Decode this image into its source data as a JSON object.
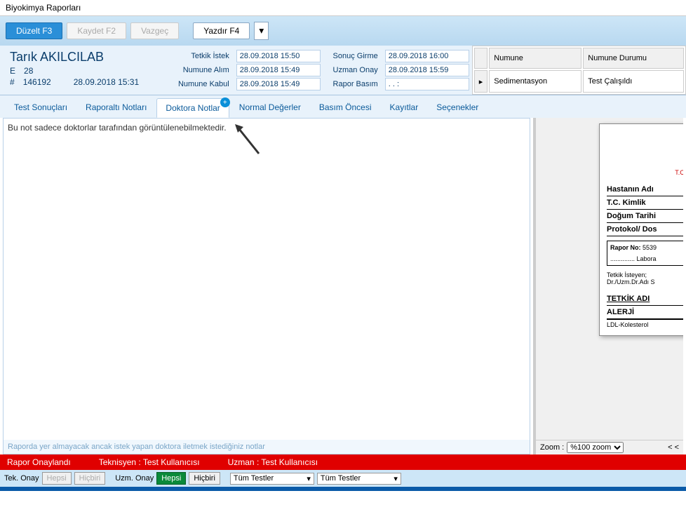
{
  "window": {
    "title": "Biyokimya Raporları"
  },
  "toolbar": {
    "edit": "Düzelt F3",
    "save": "Kaydet F2",
    "cancel": "Vazgeç",
    "print": "Yazdır F4"
  },
  "patient": {
    "name": "Tarık AKILCILAB",
    "gender": "E",
    "age": "28",
    "file_no_prefix": "#",
    "file_no": "146192",
    "file_date": "28.09.2018 15:31"
  },
  "dates": {
    "request_lbl": "Tetkik İstek",
    "request_val": "28.09.2018 15:50",
    "sample_take_lbl": "Numune Alım",
    "sample_take_val": "28.09.2018 15:49",
    "sample_accept_lbl": "Numune Kabul",
    "sample_accept_val": "28.09.2018 15:49",
    "result_lbl": "Sonuç Girme",
    "result_val": "28.09.2018 16:00",
    "approval_lbl": "Uzman Onay",
    "approval_val": "28.09.2018 15:59",
    "print_lbl": "Rapor Basım",
    "print_val": ". .     :"
  },
  "sample_table": {
    "col1": "Numune",
    "col2": "Numune Durumu",
    "rows": [
      {
        "name": "Sedimentasyon",
        "status": "Test Çalışıldı"
      }
    ]
  },
  "tabs": {
    "results": "Test Sonuçları",
    "subnotes": "Raporaltı Notları",
    "doctor_notes": "Doktora Notlar",
    "normal": "Normal Değerler",
    "preprint": "Basım Öncesi",
    "records": "Kayıtlar",
    "options": "Seçenekler"
  },
  "note": {
    "text": "Bu not sadece doktorlar tarafından görüntülenebilmektedir.",
    "hint": "Raporda yer almayacak ancak istek yapan doktora iletmek istediğiniz notlar"
  },
  "preview": {
    "ministry": "T.C. Sağlık Bakanlığı",
    "f_patient": "Hastanın Adı",
    "f_tc": "T.C. Kimlik",
    "f_dob": "Doğum Tarihi",
    "f_protocol": "Protokol/ Dos",
    "rapor_no_lbl": "Rapor No:",
    "rapor_no_val": "5539",
    "labora": ".............. Labora",
    "requestor_lbl": "Tetkik İsteyen;",
    "requestor_val": "Dr./Uzm.Dr.Adı S",
    "tetkik_adi": "TETKİK ADI",
    "alerji": "ALERJİ",
    "ldl": "LDL-Kolesterol",
    "zoom_lbl": "Zoom :",
    "zoom_val": "%100 zoom",
    "nav": "<  <"
  },
  "status": {
    "approved": "Rapor Onaylandı",
    "tech_lbl": "Teknisyen :",
    "tech_val": "Test Kullanıcısı",
    "spec_lbl": "Uzman :",
    "spec_val": "Test Kullanıcısı"
  },
  "bottom": {
    "tek_onay": "Tek. Onay",
    "hepsi": "Hepsi",
    "hicbiri": "Hiçbiri",
    "uzm_onay": "Uzm. Onay",
    "sel_tests": "Tüm Testler"
  }
}
